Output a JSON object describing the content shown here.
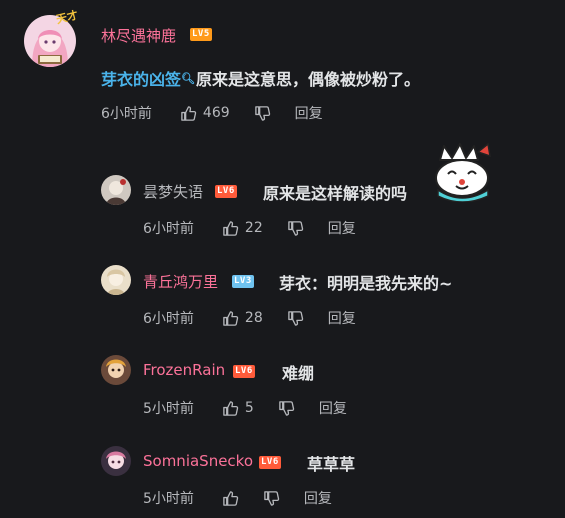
{
  "colors": {
    "background": "#18191c",
    "pink_username": "#fb7299",
    "plain_username": "#b6b8bc",
    "topic_link": "#4ab3ea"
  },
  "root": {
    "username": "林尽遇神鹿",
    "level": "LV5",
    "pendant_text": "天才",
    "topic": "芽衣的凶签",
    "text": "原来是这意思，偶像被炒粉了。",
    "time": "6小时前",
    "likes": "469",
    "reply_label": "回复"
  },
  "replies": [
    {
      "username": "昙梦失语",
      "level": "LV6",
      "text": "原来是这样解读的吗",
      "time": "6小时前",
      "likes": "22",
      "reply_label": "回复",
      "sticker": "crowned-cat-sticker"
    },
    {
      "username": "青丘鸿万里",
      "level": "LV3",
      "text": "芽衣：明明是我先来的~",
      "time": "6小时前",
      "likes": "28",
      "reply_label": "回复"
    },
    {
      "username": "FrozenRain",
      "level": "LV6",
      "text": "难绷",
      "time": "5小时前",
      "likes": "5",
      "reply_label": "回复"
    },
    {
      "username": "SomniaSnecko",
      "level": "LV6",
      "text": "草草草",
      "time": "5小时前",
      "likes": "",
      "reply_label": "回复"
    }
  ]
}
